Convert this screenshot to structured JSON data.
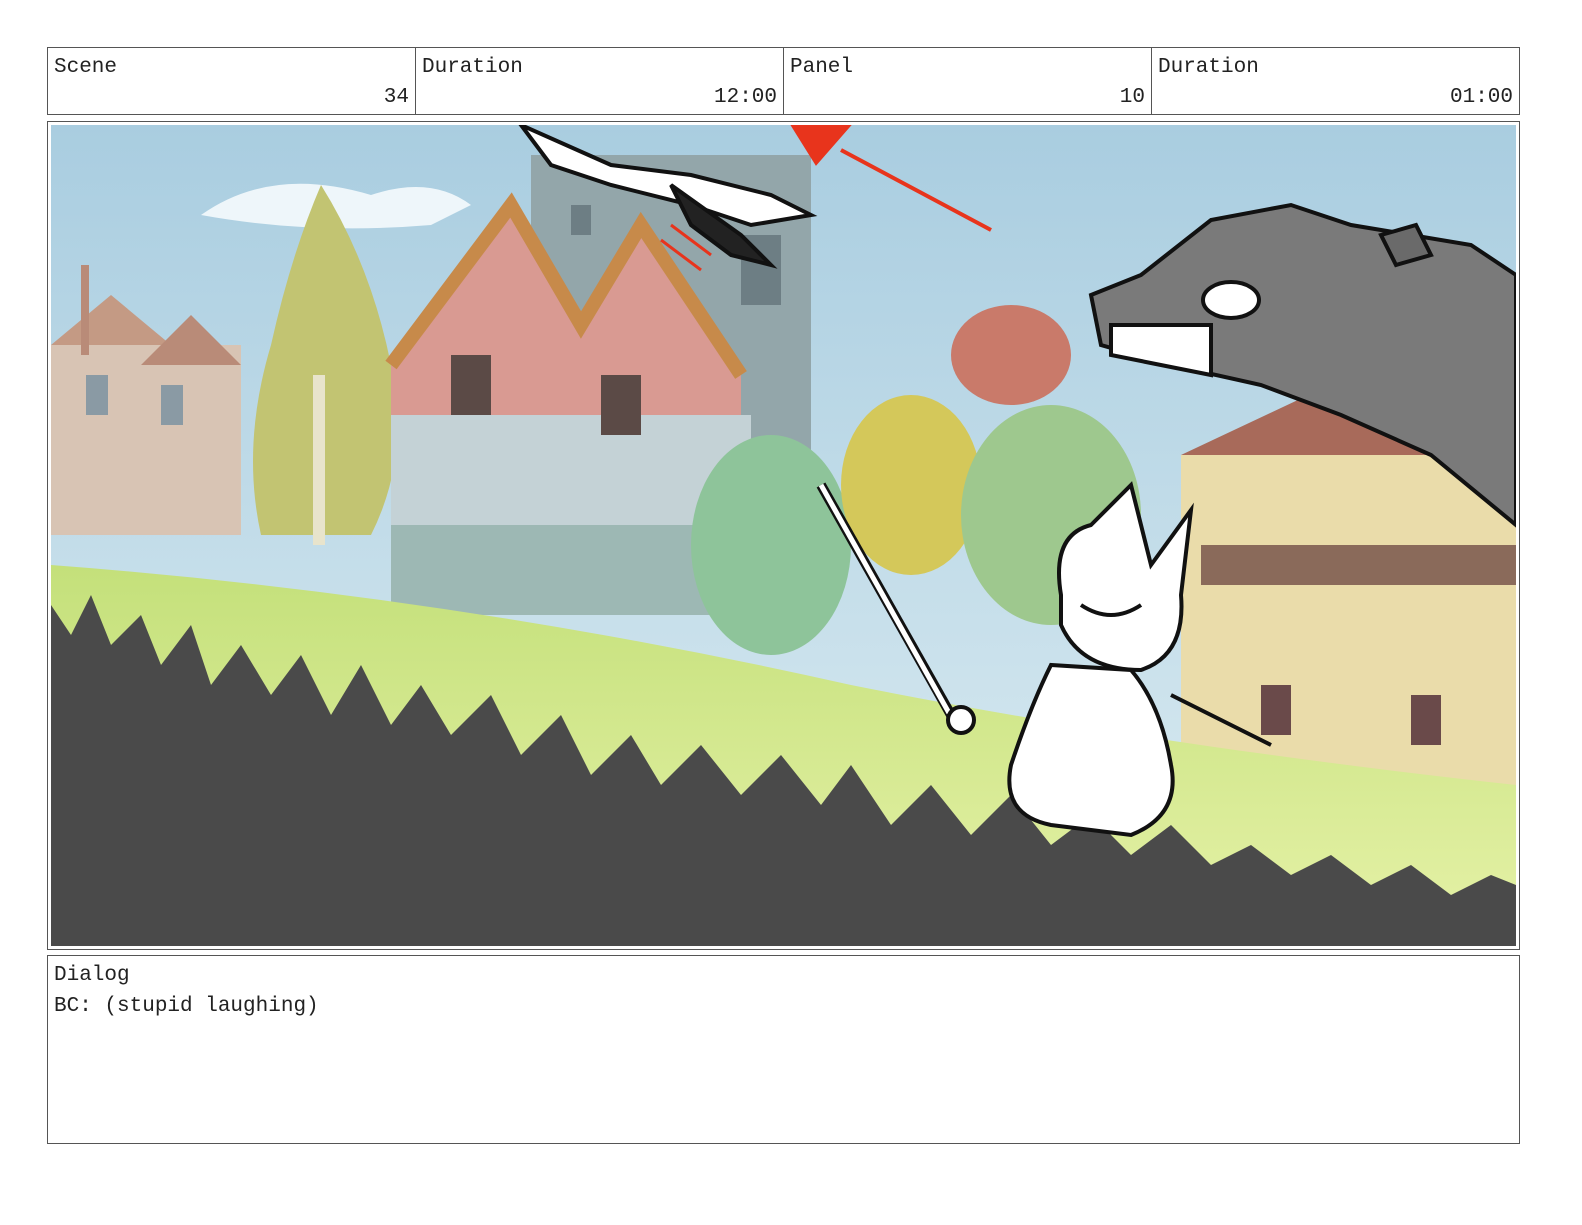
{
  "header": {
    "scene_label": "Scene",
    "scene_value": "34",
    "scene_duration_label": "Duration",
    "scene_duration_value": "12:00",
    "panel_label": "Panel",
    "panel_value": "10",
    "panel_duration_label": "Duration",
    "panel_duration_value": "01:00"
  },
  "dialog": {
    "label": "Dialog",
    "text": "BC: (stupid laughing)"
  },
  "colors": {
    "arrow": "#e8341c",
    "grass_silhouette": "#4a4a4a",
    "wolf_head": "#7a7a7a",
    "border": "#555555"
  }
}
